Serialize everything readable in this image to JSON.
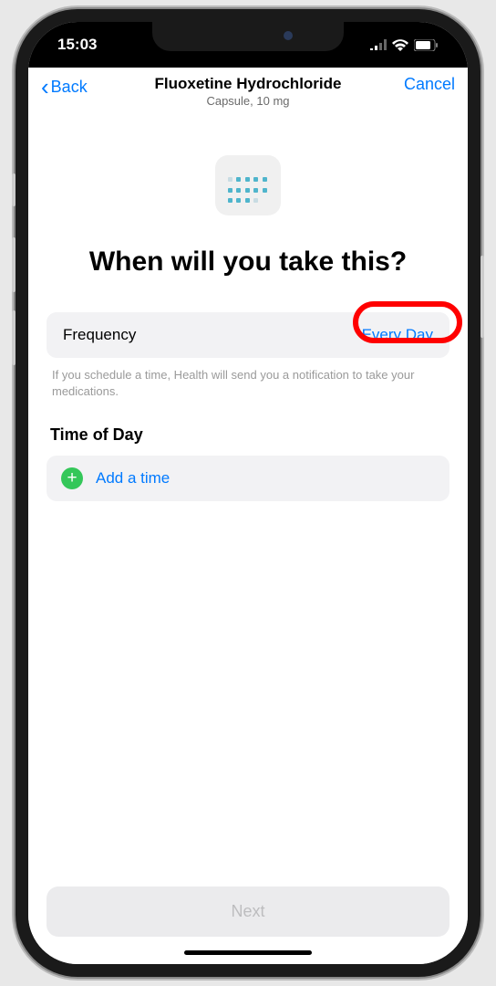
{
  "status": {
    "time": "15:03"
  },
  "nav": {
    "back_label": "Back",
    "title": "Fluoxetine Hydrochloride",
    "subtitle": "Capsule, 10 mg",
    "cancel_label": "Cancel"
  },
  "heading": "When will you take this?",
  "frequency": {
    "label": "Frequency",
    "value": "Every Day"
  },
  "helper_text": "If you schedule a time, Health will send you a notification to take your medications.",
  "time_section": {
    "title": "Time of Day",
    "add_label": "Add a time"
  },
  "next_button": "Next"
}
